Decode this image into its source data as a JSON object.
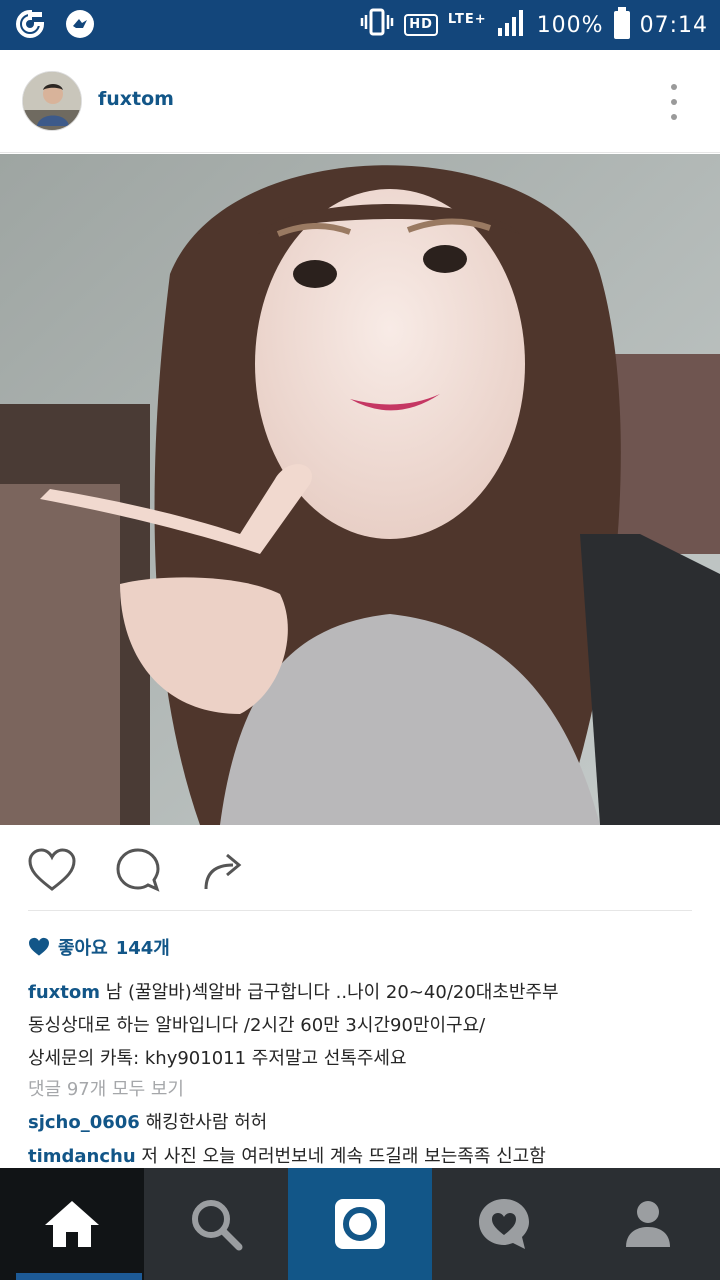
{
  "status_bar": {
    "network": "HD",
    "signal": "LTE+",
    "battery": "100%",
    "time": "07:14",
    "left_icons": [
      "app-circle-icon",
      "bird-notification-icon"
    ]
  },
  "post": {
    "username": "fuxtom",
    "likes": {
      "label": "좋아요",
      "count": "144개"
    },
    "caption": {
      "username": "fuxtom",
      "lines": [
        "남 (꿀알바)섹알바 급구합니다 ..나이 20~40/20대초반주부",
        "동싱상대로 하는 알바입니다 /2시간 60만 3시간90만이구요/",
        "상세문의 카톡: khy901011 주저말고 선톡주세요"
      ]
    },
    "view_all_comments": "댓글 97개 모두 보기",
    "comments": [
      {
        "username": "sjcho_0606",
        "text": "해킹한사람 허허"
      },
      {
        "username": "timdanchu",
        "text": "저 사진 오늘 여러번보네 계속 뜨길래 보는족족 신고함"
      }
    ]
  },
  "nav": {
    "tabs": [
      "home",
      "search",
      "camera",
      "activity",
      "profile"
    ]
  },
  "colors": {
    "status_bar": "#13467b",
    "link_blue": "#125688",
    "tabbar": "#2b2f33",
    "camera_tab": "#125688"
  }
}
